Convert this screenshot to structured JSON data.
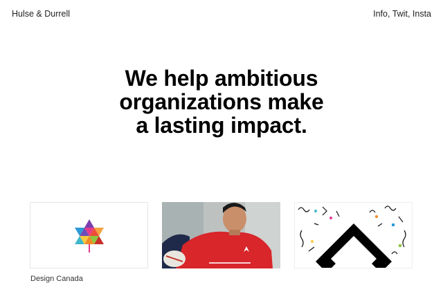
{
  "header": {
    "brand": "Hulse & Durrell",
    "nav": [
      {
        "label": "Info"
      },
      {
        "label": "Twit"
      },
      {
        "label": "Insta"
      }
    ],
    "separator": ", "
  },
  "hero": {
    "lines": [
      "We help ambitious",
      "organizations make",
      "a lasting impact."
    ]
  },
  "work": [
    {
      "caption": "Design Canada",
      "icon": "maple-leaf-logo"
    },
    {
      "caption": "",
      "icon": "rugby-player-photo"
    },
    {
      "caption": "",
      "icon": "geometric-pattern-graphic"
    }
  ],
  "colors": {
    "text": "#111111",
    "background": "#ffffff",
    "canada_red": "#d62828"
  }
}
